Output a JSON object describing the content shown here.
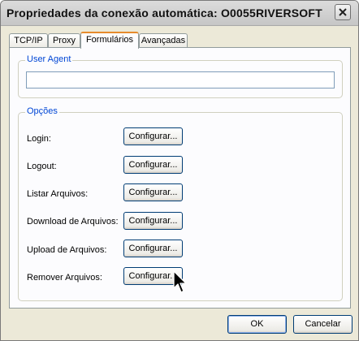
{
  "window": {
    "title": "Propriedades da conexão automática: O0055RIVERSOFT"
  },
  "tabs": [
    {
      "label": "TCP/IP",
      "active": false
    },
    {
      "label": "Proxy",
      "active": false
    },
    {
      "label": "Formulários",
      "active": true
    },
    {
      "label": "Avançadas",
      "active": false
    }
  ],
  "user_agent": {
    "legend": "User Agent",
    "value": ""
  },
  "options": {
    "legend": "Opções",
    "button_label": "Configurar...",
    "items": [
      {
        "label": "Login:"
      },
      {
        "label": "Logout:"
      },
      {
        "label": "Listar Arquivos:"
      },
      {
        "label": "Download de Arquivos:"
      },
      {
        "label": "Upload de Arquivos:"
      },
      {
        "label": "Remover Arquivos:"
      }
    ]
  },
  "footer": {
    "ok_label": "OK",
    "cancel_label": "Cancelar"
  },
  "icons": {
    "close": "close-icon",
    "cursor": "mouse-pointer-icon"
  },
  "colors": {
    "group_label": "#0046d5",
    "active_tab_accent": "#e68b2c",
    "button_border": "#003c74"
  }
}
